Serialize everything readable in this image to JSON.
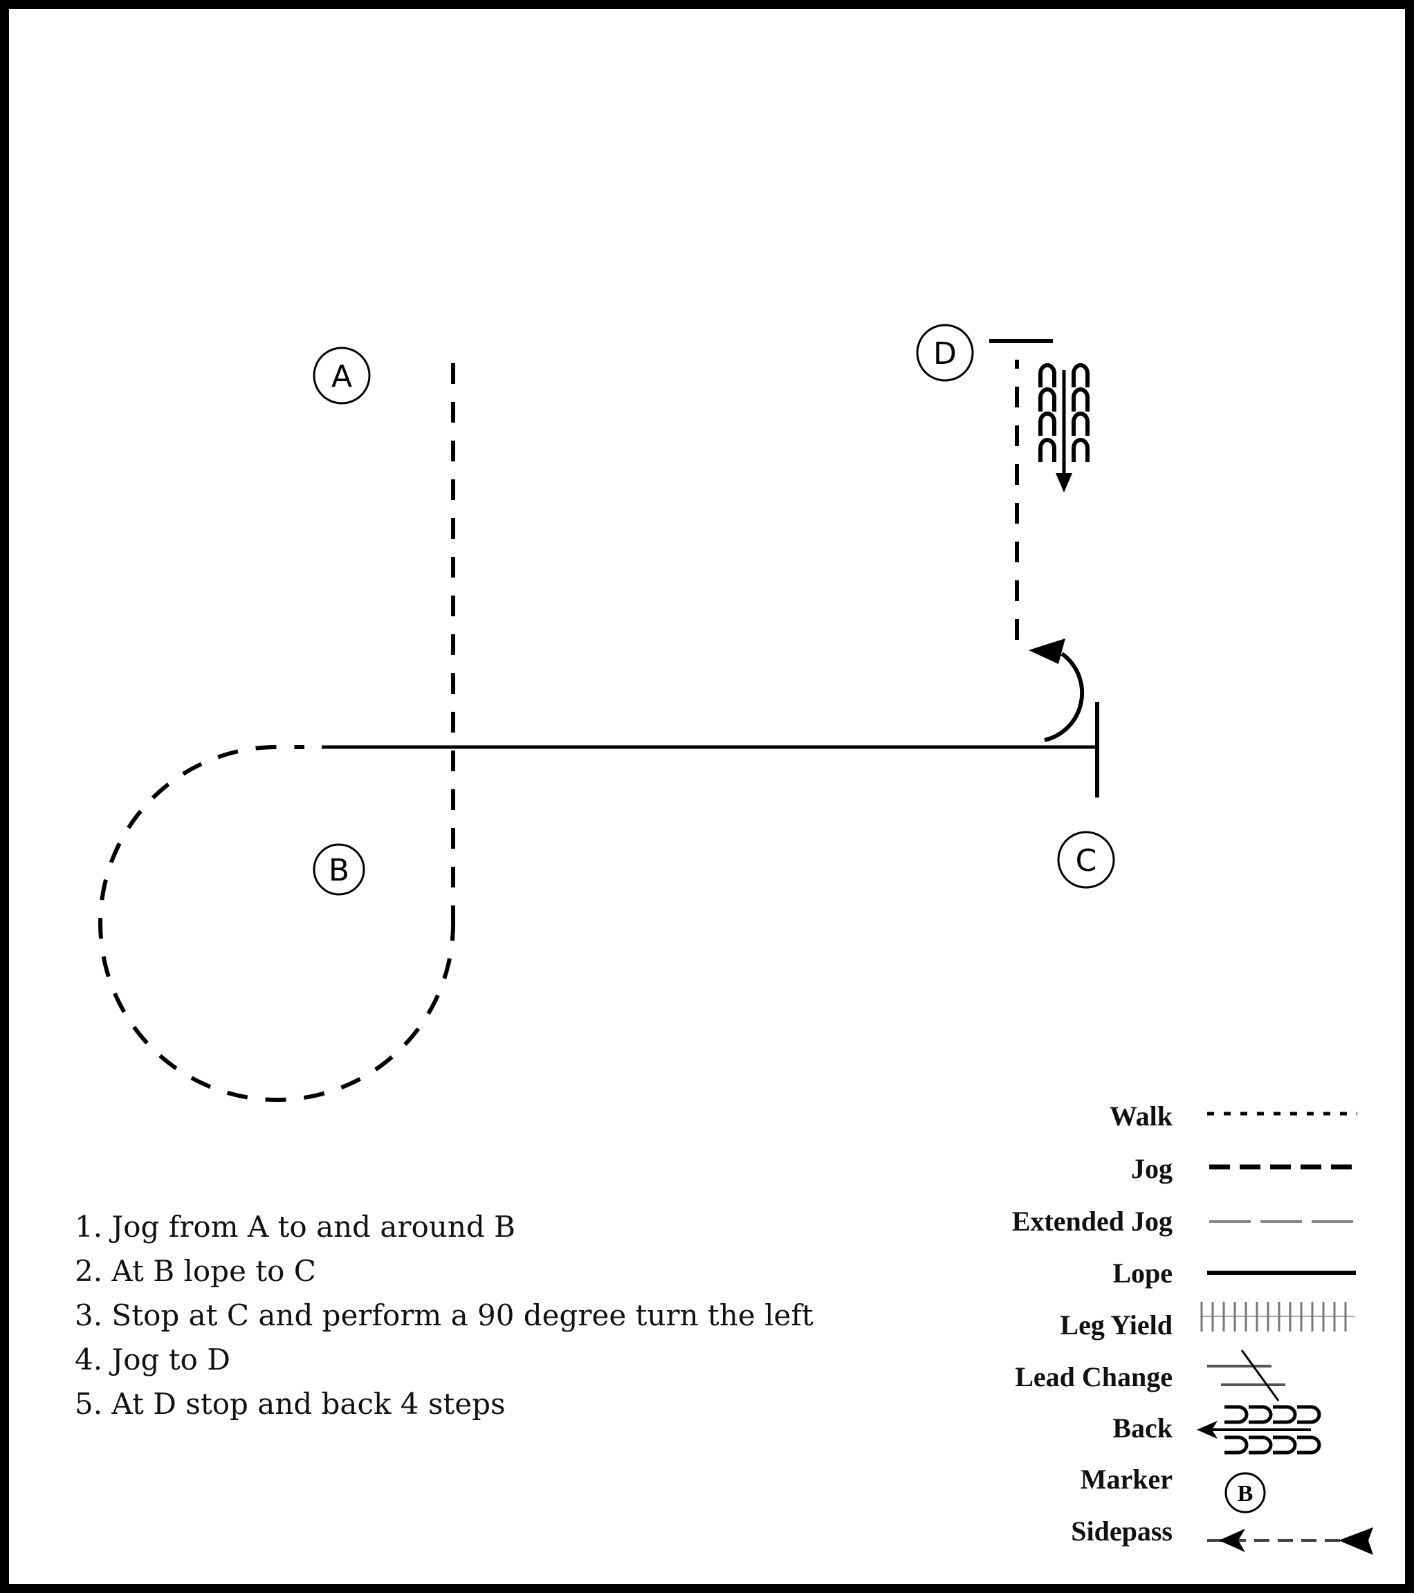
{
  "pattern": {
    "markers": [
      {
        "id": "A",
        "label": "A"
      },
      {
        "id": "B",
        "label": "B"
      },
      {
        "id": "C",
        "label": "C"
      },
      {
        "id": "D",
        "label": "D"
      }
    ]
  },
  "instructions": [
    "1. Jog from A to and around B",
    "2. At B lope to C",
    "3. Stop at C and perform a 90 degree turn the left",
    "4. Jog to D",
    "5. At D stop and back 4 steps"
  ],
  "legend": {
    "items": [
      {
        "label": "Walk",
        "icon": "walk-line-icon"
      },
      {
        "label": "Jog",
        "icon": "jog-line-icon"
      },
      {
        "label": "Extended Jog",
        "icon": "extended-jog-line-icon"
      },
      {
        "label": "Lope",
        "icon": "lope-line-icon"
      },
      {
        "label": "Leg Yield",
        "icon": "leg-yield-icon"
      },
      {
        "label": "Lead Change",
        "icon": "lead-change-icon"
      },
      {
        "label": "Back",
        "icon": "back-icon"
      },
      {
        "label": "Marker",
        "icon": "marker-icon"
      },
      {
        "label": "Sidepass",
        "icon": "sidepass-icon"
      }
    ],
    "marker_sample": "B"
  },
  "colors": {
    "ink": "#000000",
    "grey_line": "#888888",
    "background": "#ffffff"
  }
}
